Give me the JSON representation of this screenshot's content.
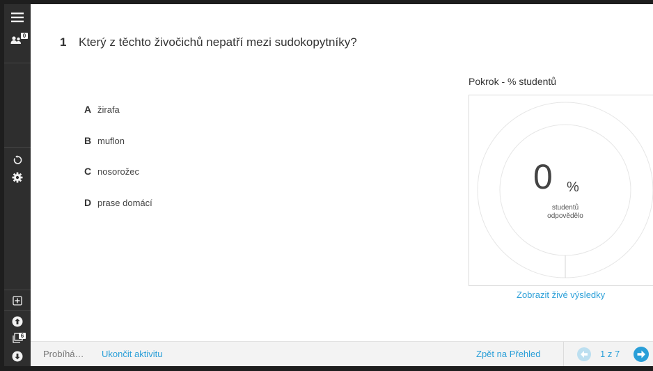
{
  "sidebar": {
    "participants_count": "0",
    "slides_count": "6"
  },
  "question": {
    "number": "1",
    "text": "Který z těchto živočichů nepatří mezi sudokopytníky?",
    "options": [
      {
        "letter": "A",
        "text": "žirafa"
      },
      {
        "letter": "B",
        "text": "muflon"
      },
      {
        "letter": "C",
        "text": "nosorožec"
      },
      {
        "letter": "D",
        "text": "prase domácí"
      }
    ]
  },
  "progress": {
    "title": "Pokrok - % studentů",
    "value": "0",
    "unit": "%",
    "caption_line1": "studentů",
    "caption_line2": "odpovědělo",
    "live_results_link": "Zobrazit živé výsledky"
  },
  "footer": {
    "status": "Probíhá…",
    "end_activity": "Ukončit aktivitu",
    "back_to_overview": "Zpět na Přehled",
    "page_indicator": "1 z 7"
  },
  "colors": {
    "accent": "#2a9fd8",
    "sidebar": "#2e2e2e",
    "footer_bg": "#f3f3f3"
  }
}
